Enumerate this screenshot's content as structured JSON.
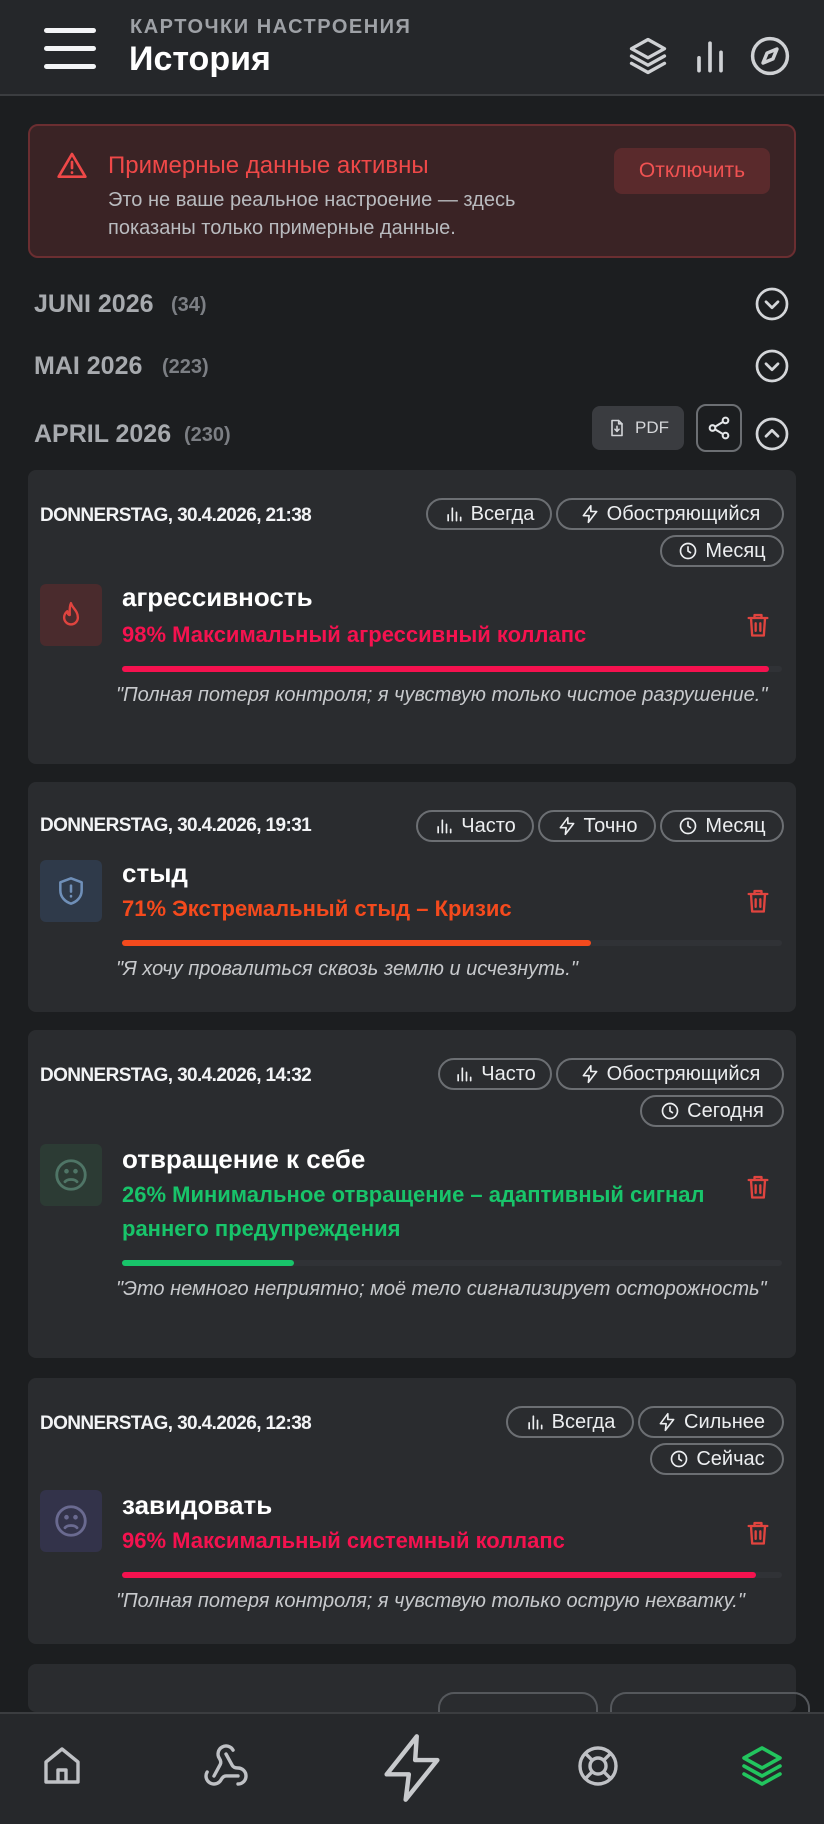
{
  "header": {
    "subtitle": "КАРТОЧКИ НАСТРОЕНИЯ",
    "title": "История"
  },
  "banner": {
    "title": "Примерные данные активны",
    "text": "Это не ваше реальное настроение — здесь показаны только примерные данные.",
    "button": "Отключить"
  },
  "months": [
    {
      "name": "JUNI 2026",
      "count": "(34)"
    },
    {
      "name": "MAI 2026",
      "count": "(223)"
    },
    {
      "name": "APRIL 2026",
      "count": "(230)"
    }
  ],
  "pdf_label": "PDF",
  "colors": {
    "critical": "#f5124f",
    "high": "#f44a1d",
    "low": "#18c46a",
    "danger": "#e0443f",
    "accent_green": "#22c55e"
  },
  "entries": [
    {
      "date": "DONNERSTAG, 30.4.2026, 21:38",
      "chips": [
        "Всегда",
        "Обостряющийся",
        "Месяц"
      ],
      "icon": "flame-icon",
      "emotion": "агрессивность",
      "level": "98% Максимальный агрессивный коллапс",
      "percent": 98,
      "quote": "\"Полная потеря контроля; я чувствую только чистое разрушение.\""
    },
    {
      "date": "DONNERSTAG, 30.4.2026, 19:31",
      "chips": [
        "Часто",
        "Точно",
        "Месяц"
      ],
      "icon": "shield-alert-icon",
      "emotion": "стыд",
      "level": "71% Экстремальный стыд – Кризис",
      "percent": 71,
      "quote": "\"Я хочу провалиться сквозь землю и исчезнуть.\""
    },
    {
      "date": "DONNERSTAG, 30.4.2026, 14:32",
      "chips": [
        "Часто",
        "Обостряющийся",
        "Сегодня"
      ],
      "icon": "sad-face-icon",
      "emotion": "отвращение к себе",
      "level": "26% Минимальное отвращение – адаптивный сигнал раннего предупреждения",
      "percent": 26,
      "quote": "\"Это немного неприятно; моё тело сигнализирует осторожность\""
    },
    {
      "date": "DONNERSTAG, 30.4.2026, 12:38",
      "chips": [
        "Всегда",
        "Сильнее",
        "Сейчас"
      ],
      "icon": "sad-face-icon",
      "emotion": "завидовать",
      "level": "96% Максимальный системный коллапс",
      "percent": 96,
      "quote": "\"Полная потеря контроля; я чувствую только острую нехватку.\""
    }
  ],
  "nav": [
    "home-icon",
    "webhook-icon",
    "lightning-icon",
    "lifebuoy-icon",
    "layers-icon"
  ]
}
